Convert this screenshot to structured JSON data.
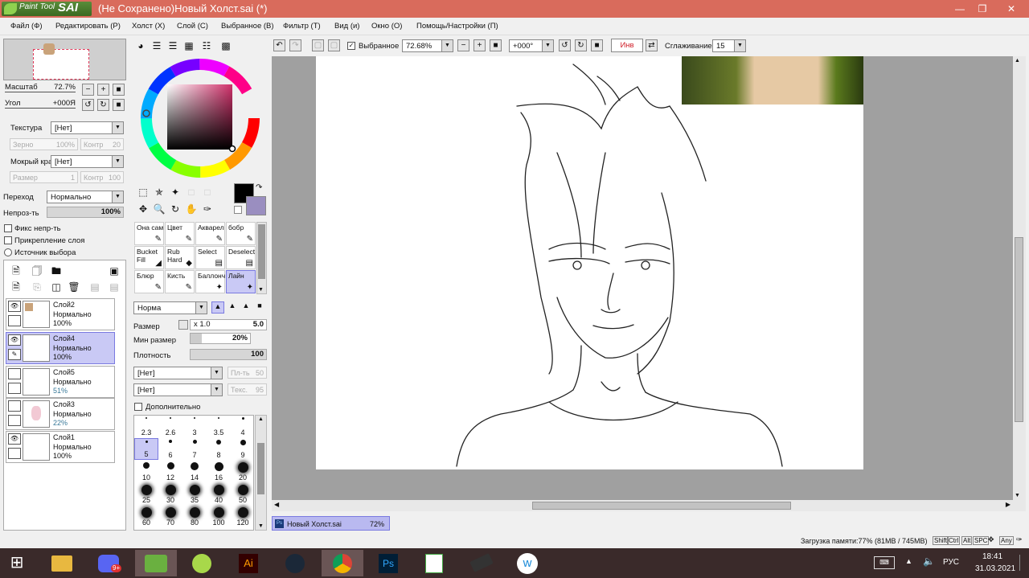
{
  "window": {
    "title": "(Не Сохранено)Новый Холст.sai (*)",
    "logo_text_small": "Paint Tool",
    "logo_text_big": "SAI"
  },
  "menu": {
    "items": [
      "Файл (Ф)",
      "Редактировать (Р)",
      "Холст (Х)",
      "Слой (С)",
      "Выбранное (В)",
      "Фильтр (Т)",
      "Вид (и)",
      "Окно (О)",
      "Помощь/Настройки (П)"
    ]
  },
  "navigator": {
    "scale_label": "Масштаб",
    "scale_value": "72.7%",
    "angle_label": "Угол",
    "angle_value": "+000Я"
  },
  "brush_settings_left": {
    "texture_label": "Текстура",
    "texture_value": "[Нет]",
    "grain_label": "Зерно",
    "grain_value": "100%",
    "contrast_label": "Контр",
    "contrast_value": "20",
    "wet_edge_label": "Мокрый край",
    "wet_edge_value": "[Нет]",
    "size_label": "Размер",
    "size_value": "1",
    "contrast2_label": "Контр",
    "contrast2_value": "100",
    "blend_label": "Переход",
    "blend_value": "Нормально",
    "opacity_label": "Непроз-ть",
    "opacity_value": "100%",
    "check_fix_opacity": "Фикс непр-ть",
    "check_clip_layer": "Прикрепление слоя",
    "radio_selection_source": "Источник выбора"
  },
  "layers": [
    {
      "name": "Слой2",
      "mode": "Нормально",
      "opacity": "100%",
      "visible": true,
      "selected": false
    },
    {
      "name": "Слой4",
      "mode": "Нормально",
      "opacity": "100%",
      "visible": true,
      "selected": true
    },
    {
      "name": "Слой5",
      "mode": "Нормально",
      "opacity": "51%",
      "visible": false,
      "selected": false
    },
    {
      "name": "Слой3",
      "mode": "Нормально",
      "opacity": "22%",
      "visible": false,
      "selected": false
    },
    {
      "name": "Слой1",
      "mode": "Нормально",
      "opacity": "100%",
      "visible": true,
      "selected": false
    }
  ],
  "colors": {
    "primary": "#000000",
    "secondary": "#9a8ec0",
    "accent_selected": "#c9c9f5",
    "title_bar": "#d96b5c"
  },
  "tools": [
    {
      "label": "Она сам",
      "selected": false
    },
    {
      "label": "Цвет",
      "selected": false
    },
    {
      "label": "Акварел",
      "selected": false
    },
    {
      "label": "бобр",
      "selected": false
    },
    {
      "label": "Bucket Fill",
      "selected": false
    },
    {
      "label": "Rub Hard",
      "selected": false
    },
    {
      "label": "Select",
      "selected": false
    },
    {
      "label": "Deselect",
      "selected": false
    },
    {
      "label": "Блюр",
      "selected": false
    },
    {
      "label": "Кисть",
      "selected": false
    },
    {
      "label": "Баллонч",
      "selected": false
    },
    {
      "label": "Лайн",
      "selected": true
    }
  ],
  "brush_settings": {
    "mode_value": "Норма",
    "size_label": "Размер",
    "size_multiplier": "x 1.0",
    "size_value": "5.0",
    "min_size_label": "Мин размер",
    "min_size_value": "20%",
    "density_label": "Плотность",
    "density_value": "100",
    "texture1_value": "[Нет]",
    "texture1_side_label": "Пл-ть",
    "texture1_side_value": "50",
    "texture2_value": "[Нет]",
    "texture2_side_label": "Текс.",
    "texture2_side_value": "95",
    "advanced_label": "Дополнительно"
  },
  "brush_sizes": [
    "2.3",
    "2.6",
    "3",
    "3.5",
    "4",
    "5",
    "6",
    "7",
    "8",
    "9",
    "10",
    "12",
    "14",
    "16",
    "20",
    "25",
    "30",
    "35",
    "40",
    "50",
    "60",
    "70",
    "80",
    "100",
    "120"
  ],
  "brush_size_selected": "5",
  "canvas_toolbar": {
    "selection_check_label": "Выбранное",
    "zoom_value": "72.68%",
    "angle_value": "+000°",
    "invert_label": "Инв",
    "stabilizer_label": "Сглаживание",
    "stabilizer_value": "15"
  },
  "document_tab": {
    "name": "Новый Холст.sai",
    "zoom": "72%"
  },
  "status": {
    "memory": "Загрузка памяти:77% (81MB / 745MB)",
    "keys": [
      "Shift",
      "Ctrl",
      "Alt",
      "SPC",
      "Any"
    ]
  },
  "taskbar": {
    "lang": "РУС",
    "time": "18:41",
    "date": "31.03.2021",
    "discord_badge": "9+"
  }
}
